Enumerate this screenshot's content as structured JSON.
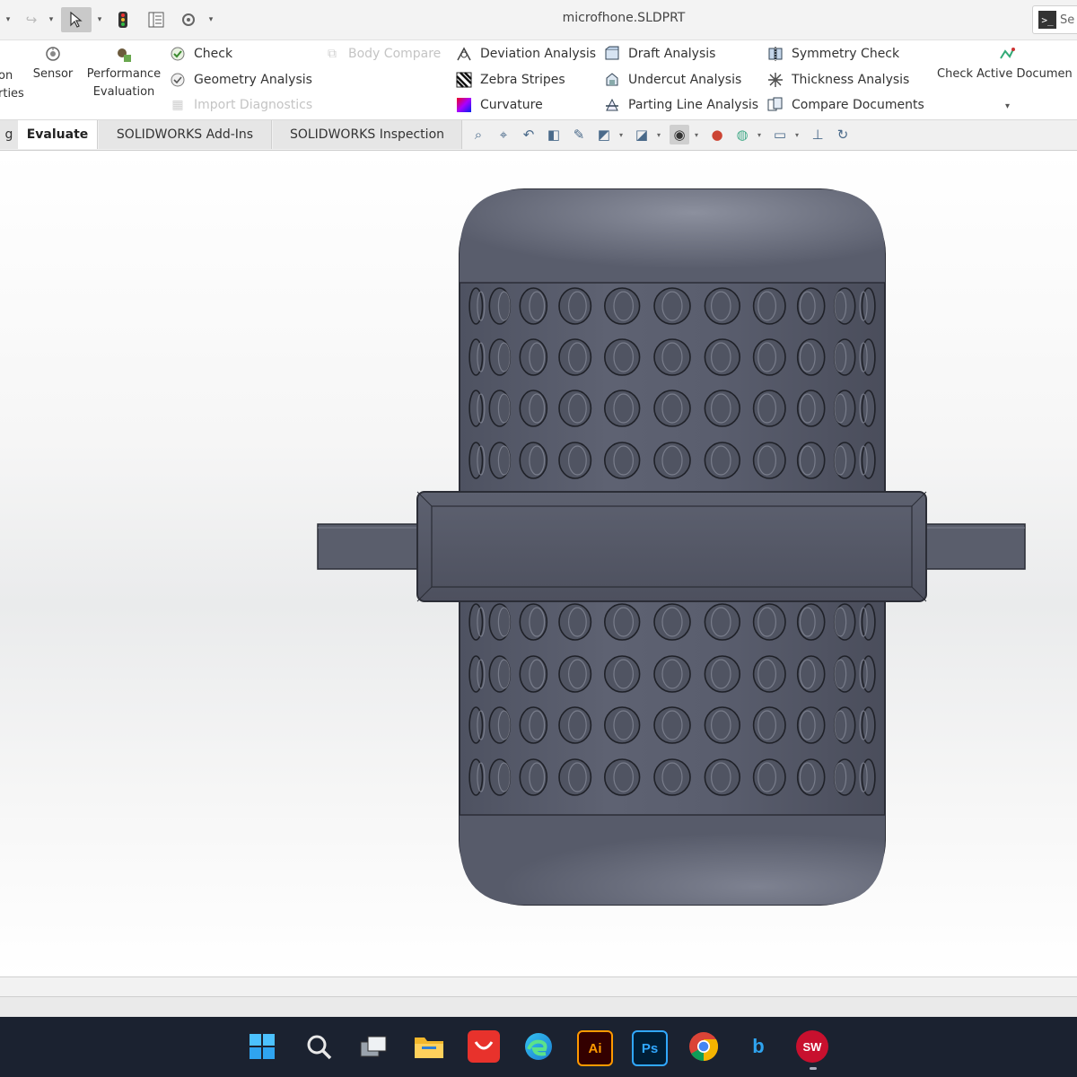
{
  "window": {
    "title": "microfhone.SLDPRT"
  },
  "search": {
    "placeholder": "Se"
  },
  "ribbon": {
    "partial_left_top": "on",
    "partial_left_bottom": "rties",
    "sensor": "Sensor",
    "performance_line1": "Performance",
    "performance_line2": "Evaluation",
    "check": "Check",
    "geometry_analysis": "Geometry Analysis",
    "import_diagnostics": "Import Diagnostics",
    "body_compare": "Body Compare",
    "deviation_analysis": "Deviation Analysis",
    "zebra_stripes": "Zebra Stripes",
    "curvature": "Curvature",
    "draft_analysis": "Draft Analysis",
    "undercut_analysis": "Undercut Analysis",
    "parting_line_analysis": "Parting Line Analysis",
    "symmetry_check": "Symmetry Check",
    "thickness_analysis": "Thickness Analysis",
    "compare_documents": "Compare Documents",
    "check_active_document": "Check Active Documen"
  },
  "tabs": [
    {
      "label": "g"
    },
    {
      "label": "Evaluate",
      "active": true
    },
    {
      "label": "SOLIDWORKS Add-Ins"
    },
    {
      "label": "SOLIDWORKS Inspection"
    }
  ],
  "taskbar": {
    "illustrator": "Ai",
    "photoshop": "Ps",
    "bing": "b",
    "solidworks": "SW"
  },
  "colors": {
    "model_body": "#5b5f6e",
    "model_highlight": "#8a8e9c",
    "model_edge": "#2b2d36",
    "taskbar_bg": "#1b2230",
    "solidworks_red": "#c8102e"
  }
}
